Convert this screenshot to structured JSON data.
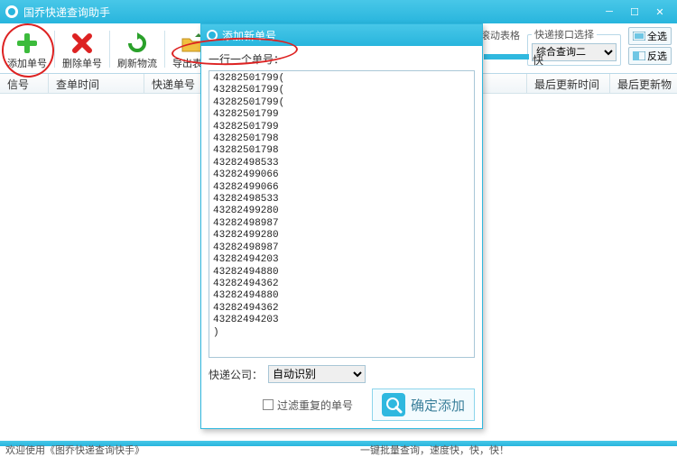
{
  "titlebar": {
    "title": "国乔快递查询助手"
  },
  "toolbar": {
    "btn_add": "添加单号",
    "btn_del": "删除单号",
    "btn_refresh": "刷新物流",
    "btn_export": "导出表格"
  },
  "options": {
    "scroll_check_label": "查询时滚动表格",
    "group_title": "快递接口选择",
    "interface_selected": "综合查询二",
    "btn_select_all": "全选",
    "btn_invert": "反选",
    "speed_label": "快"
  },
  "columns": {
    "c0": "信号",
    "c1": "查单时间",
    "c2": "快递单号",
    "c3": "最后更新时间",
    "c4": "最后更新物"
  },
  "dialog": {
    "title": "添加新单号",
    "label_one_per_line": "一行一个单号：",
    "tracking_numbers": "43282501799(\n43282501799(\n43282501799(\n43282501799\n43282501799\n43282501798\n43282501798\n43282498533\n43282499066\n43282499066\n43282498533\n43282499280\n43282498987\n43282499280\n43282498987\n43282494203\n43282494880\n43282494362\n43282494880\n43282494362\n43282494203\n)",
    "company_label": "快递公司：",
    "company_selected": "自动识别",
    "filter_dup_label": "过滤重复的单号",
    "confirm_label": "确定添加",
    "confirm_icon_text": "查快递"
  },
  "footer": {
    "welcome": "欢迎使用《图乔快递查询快手》",
    "slogan": "一键批量查询，速度快，快，快！"
  }
}
